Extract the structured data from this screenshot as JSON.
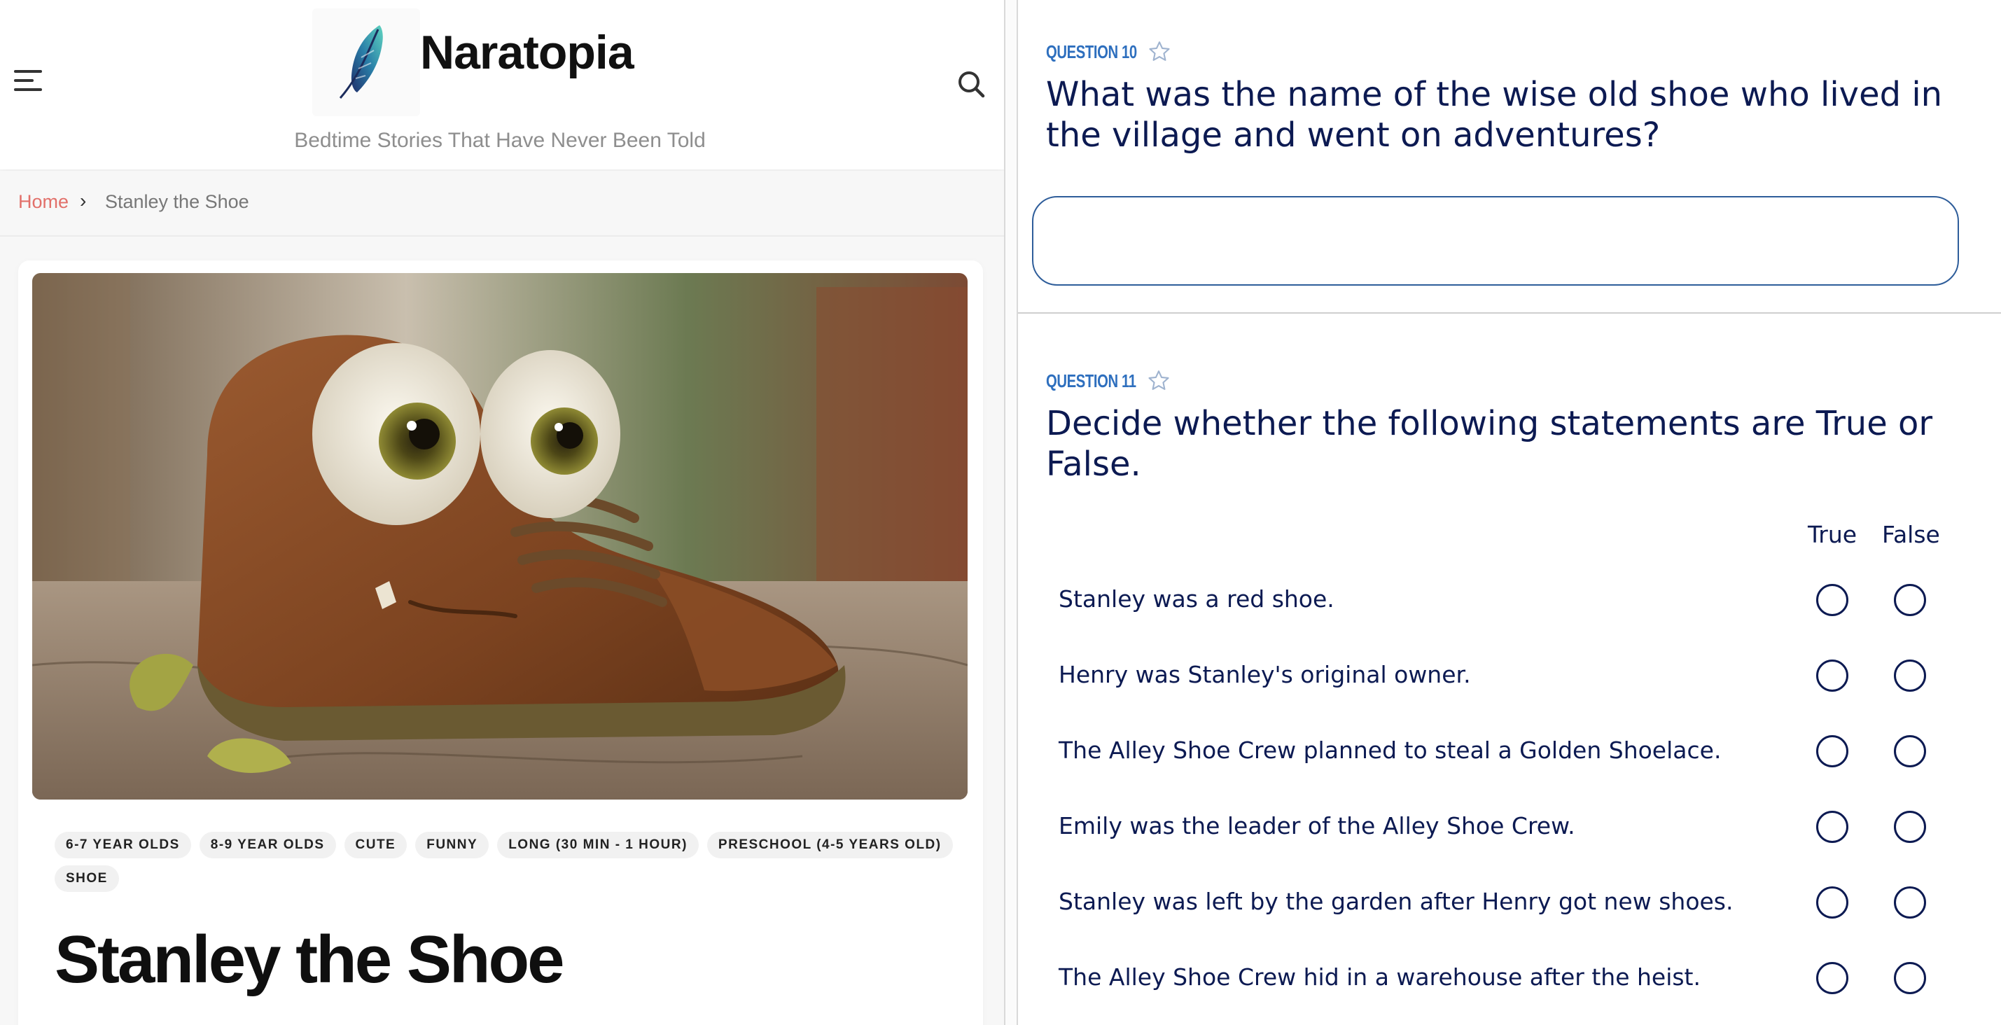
{
  "site": {
    "name": "Naratopia",
    "tagline": "Bedtime Stories That Have Never Been Told"
  },
  "breadcrumb": {
    "home": "Home",
    "separator": "›",
    "current": "Stanley the Shoe"
  },
  "story": {
    "tags": [
      "6-7 YEAR OLDS",
      "8-9 YEAR OLDS",
      "CUTE",
      "FUNNY",
      "LONG (30 MIN - 1 HOUR)",
      "PRESCHOOL (4-5 YEARS OLD)",
      "SHOE"
    ],
    "title": "Stanley the Shoe"
  },
  "quiz": {
    "q10": {
      "label": "QUESTION 10",
      "text": "What was the name of the wise old shoe who lived in the village and went on adventures?",
      "answer_value": ""
    },
    "q11": {
      "label": "QUESTION 11",
      "text": "Decide whether the following statements are True or False.",
      "col_true": "True",
      "col_false": "False",
      "statements": [
        "Stanley was a red shoe.",
        "Henry was Stanley's original owner.",
        "The Alley Shoe Crew planned to steal a Golden Shoelace.",
        "Emily was the leader of the Alley Shoe Crew.",
        "Stanley was left by the garden after Henry got new shoes.",
        "The Alley Shoe Crew hid in a warehouse after the heist."
      ]
    }
  },
  "icons": {
    "menu": "hamburger-menu-icon",
    "search": "search-icon",
    "logo": "feather-logo-icon",
    "favorite": "star-outline-icon"
  },
  "colors": {
    "breadcrumb_link": "#e2706a",
    "question_label": "#2e6fbe",
    "question_text": "#0c1a52",
    "tag_bg": "#f1f1f1"
  }
}
